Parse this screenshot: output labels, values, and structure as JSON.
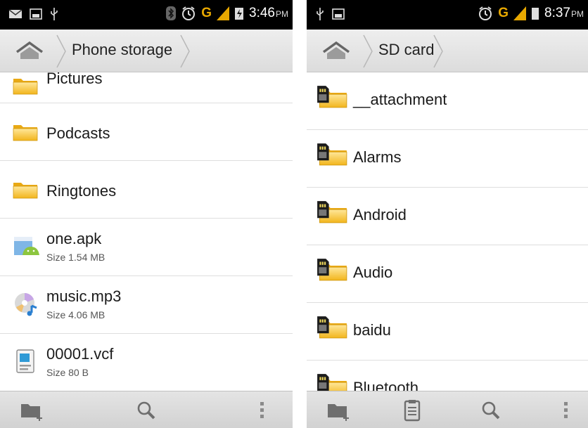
{
  "left": {
    "status": {
      "time": "3:46",
      "ampm": "PM",
      "network": "G"
    },
    "breadcrumb": {
      "location": "Phone storage"
    },
    "items": [
      {
        "name": "Pictures",
        "type": "folder"
      },
      {
        "name": "Podcasts",
        "type": "folder"
      },
      {
        "name": "Ringtones",
        "type": "folder"
      },
      {
        "name": "one.apk",
        "size": "Size 1.54 MB",
        "type": "apk"
      },
      {
        "name": "music.mp3",
        "size": "Size 4.06 MB",
        "type": "audio"
      },
      {
        "name": "00001.vcf",
        "size": "Size 80 B",
        "type": "vcard"
      }
    ]
  },
  "right": {
    "status": {
      "time": "8:37",
      "ampm": "PM",
      "network": "G"
    },
    "breadcrumb": {
      "location": "SD card"
    },
    "items": [
      {
        "name": "__attachment",
        "type": "sd-folder"
      },
      {
        "name": "Alarms",
        "type": "sd-folder"
      },
      {
        "name": "Android",
        "type": "sd-folder"
      },
      {
        "name": "Audio",
        "type": "sd-folder"
      },
      {
        "name": "baidu",
        "type": "sd-folder"
      },
      {
        "name": "Bluetooth",
        "type": "sd-folder"
      }
    ]
  },
  "icons": {
    "home": "home-icon",
    "new_folder": "new-folder-icon",
    "search": "search-icon",
    "menu": "overflow-menu-icon",
    "paste": "clipboard-icon"
  },
  "colors": {
    "folder": "#f6c12e",
    "network": "#e8a800",
    "statusbar": "#000000"
  }
}
